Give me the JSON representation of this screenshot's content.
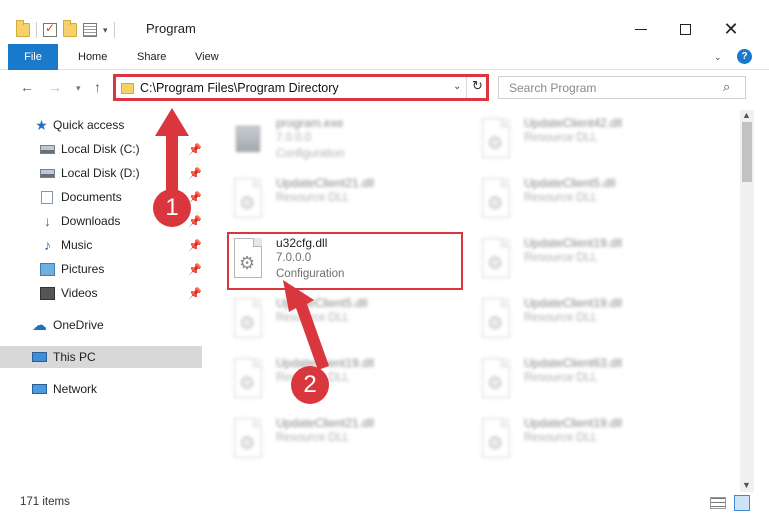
{
  "window": {
    "title": "Program",
    "controls": {
      "minimize": "minimize",
      "maximize": "maximize",
      "close": "close"
    }
  },
  "ribbon": {
    "tabs": [
      "File",
      "Home",
      "Share",
      "View"
    ],
    "help": "?"
  },
  "nav": {
    "address": "C:\\Program Files\\Program Directory",
    "search_placeholder": "Search Program"
  },
  "sidebar": {
    "items": [
      {
        "label": "Quick access",
        "icon": "star-icon",
        "pinned": false
      },
      {
        "label": "Local Disk (C:)",
        "icon": "drive-icon",
        "pinned": true
      },
      {
        "label": "Local Disk (D:)",
        "icon": "drive-icon",
        "pinned": true
      },
      {
        "label": "Documents",
        "icon": "documents-icon",
        "pinned": true
      },
      {
        "label": "Downloads",
        "icon": "download-icon",
        "pinned": true
      },
      {
        "label": "Music",
        "icon": "music-icon",
        "pinned": true
      },
      {
        "label": "Pictures",
        "icon": "pictures-icon",
        "pinned": true
      },
      {
        "label": "Videos",
        "icon": "videos-icon",
        "pinned": true
      },
      {
        "label": "OneDrive",
        "icon": "cloud-icon",
        "pinned": false
      },
      {
        "label": "This PC",
        "icon": "computer-icon",
        "pinned": false,
        "selected": true
      },
      {
        "label": "Network",
        "icon": "network-icon",
        "pinned": false
      }
    ]
  },
  "files": {
    "left": [
      {
        "name": "program.exe",
        "meta1": "7.0.0.0",
        "meta2": "Configuration",
        "type": "exe"
      },
      {
        "name": "UpdateClient21.dll",
        "meta1": "Resource DLL",
        "meta2": "",
        "type": "dll"
      },
      {
        "name": "u32cfg.dll",
        "meta1": "7.0.0.0",
        "meta2": "Configuration",
        "type": "dll",
        "highlighted": true
      },
      {
        "name": "UpdateClient5.dll",
        "meta1": "Resource DLL",
        "meta2": "",
        "type": "dll"
      },
      {
        "name": "UpdateClient19.dll",
        "meta1": "Resource DLL",
        "meta2": "",
        "type": "dll"
      },
      {
        "name": "UpdateClient21.dll",
        "meta1": "Resource DLL",
        "meta2": "",
        "type": "dll"
      }
    ],
    "right": [
      {
        "name": "UpdateClient42.dll",
        "meta1": "Resource DLL",
        "meta2": "",
        "type": "dll"
      },
      {
        "name": "UpdateClient5.dll",
        "meta1": "Resource DLL",
        "meta2": "",
        "type": "dll"
      },
      {
        "name": "UpdateClient19.dll",
        "meta1": "Resource DLL",
        "meta2": "",
        "type": "dll"
      },
      {
        "name": "UpdateClient19.dll",
        "meta1": "Resource DLL",
        "meta2": "",
        "type": "dll"
      },
      {
        "name": "UpdateClient63.dll",
        "meta1": "Resource DLL",
        "meta2": "",
        "type": "dll"
      },
      {
        "name": "UpdateClient19.dll",
        "meta1": "Resource DLL",
        "meta2": "",
        "type": "dll"
      }
    ]
  },
  "status": {
    "item_count": "171 items"
  },
  "annotations": {
    "step1": "1",
    "step2": "2",
    "color": "#d9363e"
  },
  "colors": {
    "accent": "#1979ca",
    "highlight": "#d9363e"
  }
}
